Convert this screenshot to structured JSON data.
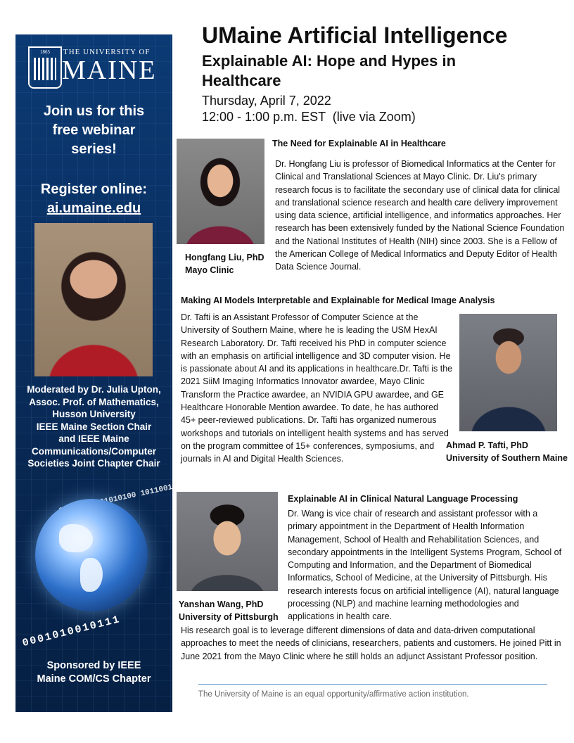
{
  "sidebar": {
    "logo": {
      "year_left": "1865",
      "university": "THE UNIVERSITY OF",
      "name": "MAINE"
    },
    "join": [
      "Join us for this",
      "free webinar",
      "series!"
    ],
    "register_label": "Register online:",
    "register_url": "ai.umaine.edu",
    "moderator": [
      "Moderated by Dr. Julia Upton,",
      "Assoc. Prof. of Mathematics,",
      "Husson University",
      "IEEE Maine Section Chair",
      "and IEEE Maine",
      "Communications/Computer",
      "Societies Joint Chapter Chair"
    ],
    "binary_top": "01010011 01010100 1011001",
    "binary_bottom": "0001010010111",
    "sponsor": [
      "Sponsored by IEEE",
      "Maine COM/CS Chapter"
    ]
  },
  "header": {
    "title": "UMaine Artificial Intelligence",
    "subtitle": "Explainable AI: Hope and Hypes in Healthcare",
    "date": "Thursday, April 7, 2022",
    "time": "12:00 - 1:00 p.m. EST  (live via Zoom)"
  },
  "talks": [
    {
      "title": "The Need for Explainable AI in Healthcare",
      "speaker_name": "Hongfang Liu, PhD",
      "speaker_affiliation": "Mayo Clinic",
      "bio": "Dr. Hongfang Liu is professor of Biomedical Informatics at the Center for Clinical and Translational Sciences at Mayo Clinic. Dr. Liu's primary research focus is to facilitate the secondary use of clinical data for clinical and translational science research and health care delivery improvement using data science, artificial intelligence, and informatics approaches. Her research has been extensively funded by the National Science Foundation and the National Institutes of Health (NIH) since 2003. She is a Fellow of the American College of Medical Informatics and Deputy Editor of Health Data Science Journal."
    },
    {
      "title": "Making AI Models Interpretable and Explainable for Medical Image Analysis",
      "speaker_name": "Ahmad P. Tafti, PhD",
      "speaker_affiliation": "University of Southern Maine",
      "bio": "Dr. Tafti is an Assistant Professor of Computer Science at the University of Southern Maine, where he is leading the USM HexAI Research Laboratory. Dr. Tafti received his PhD in computer science with an emphasis on artificial intelligence and 3D computer vision. He is passionate about AI and its applications in healthcare.Dr. Tafti is the 2021 SiiM Imaging Informatics Innovator awardee, Mayo Clinic Transform the Practice awardee, an NVIDIA GPU awardee, and GE Healthcare Honorable Mention awardee. To date, he has authored 45+ peer-reviewed publications. Dr. Tafti has organized numerous workshops and tutorials on intelligent health systems and has served on the program committee of 15+ conferences, symposiums, and journals in AI and Digital Health Sciences."
    },
    {
      "title": "Explainable AI in Clinical Natural Language Processing",
      "speaker_name": "Yanshan Wang, PhD",
      "speaker_affiliation": "University of Pittsburgh",
      "bio": "Dr. Wang is vice chair of research and assistant professor with a primary appointment in the Department of Health Information Management, School of Health and Rehabilitation Sciences, and secondary appointments in the Intelligent Systems Program, School of Computing and Information, and the Department of Biomedical Informatics, School of Medicine, at the University of Pittsburgh. His research interests focus on artificial intelligence (AI), natural language processing (NLP) and machine learning methodologies and applications in health care.",
      "bio_continued": "His research goal is to leverage different dimensions of data and data-driven computational approaches to meet the needs of clinicians, researchers, patients and customers. He joined Pitt in June 2021 from the Mayo Clinic where he still holds an adjunct Assistant Professor position."
    }
  ],
  "footer": "The University of Maine is an equal opportunity/affirmative action institution.",
  "colors": {
    "sidebar_bg": "#0b3a74",
    "rule": "#6a9bd1"
  }
}
